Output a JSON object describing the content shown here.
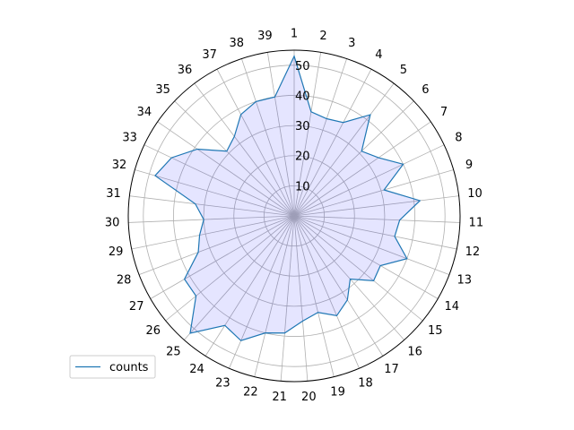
{
  "chart_data": {
    "type": "radar",
    "title": "",
    "categories": [
      "1",
      "2",
      "3",
      "4",
      "5",
      "6",
      "7",
      "8",
      "9",
      "10",
      "11",
      "12",
      "13",
      "14",
      "15",
      "16",
      "17",
      "18",
      "19",
      "20",
      "21",
      "22",
      "23",
      "24",
      "25",
      "26",
      "27",
      "28",
      "29",
      "30",
      "31",
      "32",
      "33",
      "34",
      "35",
      "36",
      "37",
      "38",
      "39"
    ],
    "series": [
      {
        "name": "counts",
        "values": [
          53,
          35,
          34,
          35,
          42,
          31,
          34,
          40,
          31,
          42,
          35,
          34,
          40,
          33,
          34,
          28,
          33,
          36,
          33,
          35,
          39,
          40,
          45,
          43,
          52,
          42,
          42,
          34,
          32,
          30,
          33,
          48,
          45,
          39,
          31,
          33,
          38,
          40,
          40
        ],
        "line_color": "#1f77b4",
        "fill_color": "#0000ff",
        "fill_alpha": 0.1
      }
    ],
    "rlim": [
      0,
      55
    ],
    "r_ticks": [
      "10",
      "20",
      "30",
      "40",
      "50"
    ],
    "grid": true,
    "legend": {
      "location": "lower-left",
      "entries": [
        "counts"
      ]
    }
  }
}
